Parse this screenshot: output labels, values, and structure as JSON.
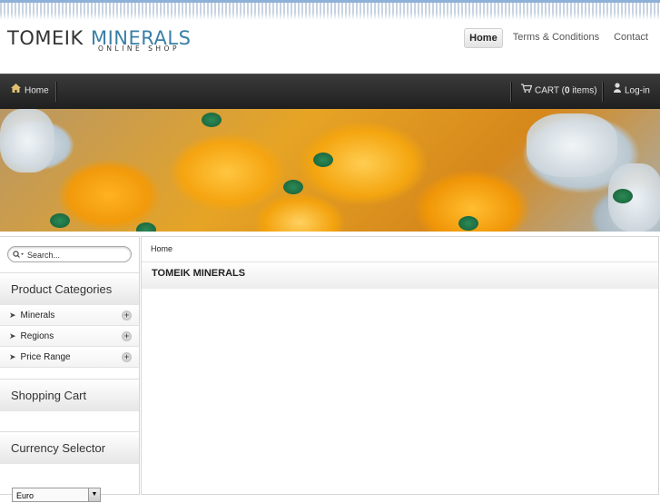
{
  "logo": {
    "left": "TOMEIK",
    "right": "MINERALS",
    "sub": "ONLINE SHOP"
  },
  "topnav": {
    "home": "Home",
    "terms": "Terms & Conditions",
    "contact": "Contact"
  },
  "navbar": {
    "home": "Home",
    "cart_prefix": "CART (",
    "cart_count": "0",
    "cart_suffix": " items)",
    "login": "Log-in"
  },
  "search": {
    "placeholder": "Search..."
  },
  "sidebar": {
    "categories_title": "Product Categories",
    "categories": [
      {
        "label": "Minerals"
      },
      {
        "label": "Regions"
      },
      {
        "label": "Price Range"
      }
    ],
    "cart_title": "Shopping Cart",
    "currency_title": "Currency Selector",
    "currency_value": "Euro"
  },
  "main": {
    "breadcrumb": "Home",
    "title": "TOMEIK MINERALS"
  },
  "colors": {
    "accent": "#3a7fa6",
    "navbar": "#2b2b2b"
  }
}
